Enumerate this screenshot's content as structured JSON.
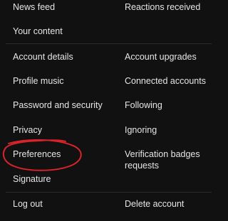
{
  "menu": {
    "section1": {
      "left": [
        "News feed",
        "Your content"
      ],
      "right": [
        "Reactions received"
      ]
    },
    "section2": {
      "left": [
        "Account details",
        "Profile music",
        "Password and security",
        "Privacy",
        "Preferences",
        "Signature"
      ],
      "right": [
        "Account upgrades",
        "Connected accounts",
        "Following",
        "Ignoring",
        "Verification badges requests"
      ]
    },
    "section3": {
      "left": [
        "Log out"
      ],
      "right": [
        "Delete account"
      ]
    }
  },
  "colors": {
    "background": "#111111",
    "text": "#e6e6e6",
    "divider": "#2c2c2c",
    "annotation": "#d9232a"
  }
}
